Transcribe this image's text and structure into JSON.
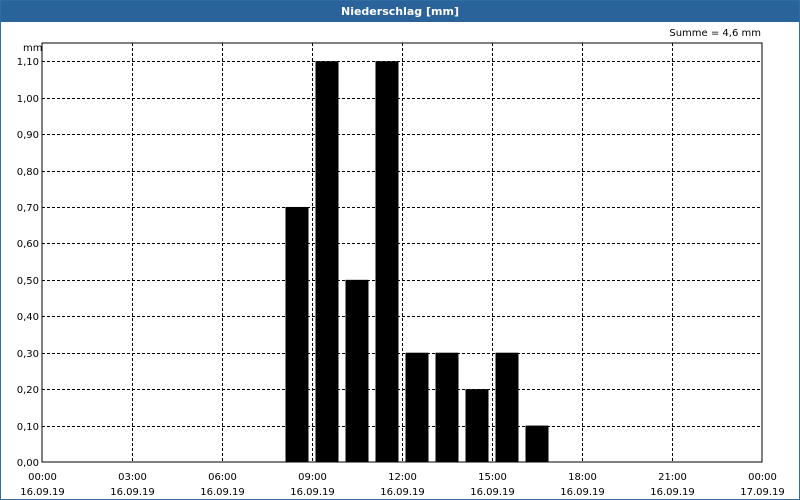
{
  "window": {
    "title": "Niederschlag [mm]"
  },
  "chart_data": {
    "type": "bar",
    "title": "Niederschlag [mm]",
    "ylabel": "mm",
    "annotation": "Summe = 4,6 mm",
    "ylim": [
      0,
      1.15
    ],
    "xlim_hours": [
      0,
      24
    ],
    "y_ticks": [
      "0,00",
      "0,10",
      "0,20",
      "0,30",
      "0,40",
      "0,50",
      "0,60",
      "0,70",
      "0,80",
      "0,90",
      "1,00",
      "1,10"
    ],
    "x_ticks": [
      {
        "time": "00:00",
        "date": "16.09.19"
      },
      {
        "time": "03:00",
        "date": "16.09.19"
      },
      {
        "time": "06:00",
        "date": "16.09.19"
      },
      {
        "time": "09:00",
        "date": "16.09.19"
      },
      {
        "time": "12:00",
        "date": "16.09.19"
      },
      {
        "time": "15:00",
        "date": "16.09.19"
      },
      {
        "time": "18:00",
        "date": "16.09.19"
      },
      {
        "time": "21:00",
        "date": "16.09.19"
      },
      {
        "time": "00:00",
        "date": "17.09.19"
      }
    ],
    "x": [
      "08:00",
      "09:00",
      "10:00",
      "11:00",
      "12:00",
      "13:00",
      "14:00",
      "15:00",
      "16:00"
    ],
    "values": [
      0.7,
      1.1,
      0.5,
      1.1,
      0.3,
      0.3,
      0.2,
      0.3,
      0.1
    ],
    "grid": true,
    "bar_color": "#000000",
    "grid_color": "#000000"
  }
}
